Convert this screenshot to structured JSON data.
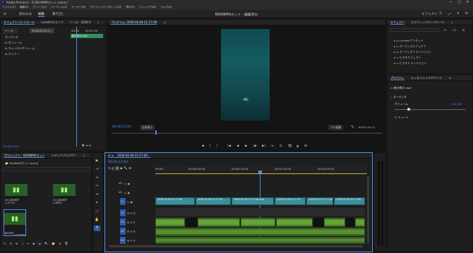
{
  "window": {
    "title": "Adobe Premiere - D:\\REANIMAカット.prproj *",
    "controls": [
      "—",
      "□",
      "✕"
    ]
  },
  "menu": [
    "ファイル(F)",
    "編集(E)",
    "クリップ(C)",
    "シーケンス(S)",
    "マーカー(M)",
    "グラフィックとタイトル(G)",
    "表示(V)",
    "ウィンドウ(W)",
    "ヘルプ(H)"
  ],
  "workspaces": {
    "home": "⌂",
    "items": [
      "読み込み",
      "編集",
      "書き出し"
    ],
    "active": "編集"
  },
  "doc_title": "REANIMAカット - 編集済み",
  "topright": {
    "label": "エフェクト",
    "icons": [
      "☰",
      "⤢",
      "⬆",
      "⚙"
    ]
  },
  "source_panel": {
    "tabs": [
      "エフェクトコントロール",
      "Lumetriスコープ",
      "ソース：2026-0",
      "»"
    ],
    "master": "ソース・",
    "seq": "2026-02-04 2...",
    "rows": [
      "オーディオ",
      "fx ボリューム",
      "fx チャンネルボリューム",
      "fx パンナー"
    ],
    "times": [
      "00:00",
      "00:01:00"
    ],
    "clip": "無の喝き.mp3",
    "timecode": "00:00:12:04"
  },
  "program": {
    "tab": "プログラム: 2026-02-04 21-17-00",
    "menu": "≡",
    "tc": "00:00:12:04",
    "fit": "全体表示",
    "quality": "フル画質",
    "wrench": "🔧",
    "duration": "00:01:15:11"
  },
  "transport": [
    "◆",
    "{",
    "}",
    "|◀",
    "◀|",
    "◀",
    "▶",
    "|▶",
    "▶|",
    "⇋",
    "⇆",
    "📷",
    "⧉",
    "⊞"
  ],
  "project": {
    "tabs": [
      "プロジェクト：REANIMAカット",
      "メディアブラウザー",
      "»"
    ],
    "path": "REANIMAカット.prproj",
    "items": [
      {
        "name": "003_無の喝き",
        "dur": "2:40:133"
      },
      {
        "name": "010_無の喝き",
        "dur": "2:48834"
      },
      {
        "name": "無の喝き",
        "dur": "1:00:38811"
      }
    ],
    "bottom_icons": [
      "✎",
      "☰",
      "⊞",
      "○",
      "═",
      "◆",
      "▤",
      "🔍",
      "📁",
      "⊕",
      "🗑"
    ]
  },
  "tools": [
    "▶",
    "⇥",
    "⇔",
    "✂",
    "↔",
    "✒",
    "▭",
    "✋",
    "T"
  ],
  "timeline": {
    "tab": "2026-02-04 21-17-00",
    "tc": "00:00:12:04",
    "ruler_labels": [
      "00:00",
      "00:00:05:00",
      "00:00:10:00",
      "00:00:15:00",
      "00:00:20:00"
    ],
    "tracks": [
      {
        "id": "V3",
        "type": "video"
      },
      {
        "id": "V2",
        "type": "video"
      },
      {
        "id": "V1",
        "type": "video"
      },
      {
        "id": "A1",
        "type": "audio"
      },
      {
        "id": "A2",
        "type": "audio"
      },
      {
        "id": "A3",
        "type": "audio"
      },
      {
        "id": "A4",
        "type": "audio"
      }
    ],
    "v1_clips": [
      "2026-02-04 21-17-00",
      "2026-02-04 21-17-00",
      "2026-02-04 21-17-00.mp4",
      "2026-02-04 21-17-0",
      "2026-02-04 21-17-00",
      "2026-02-04 21-17-00"
    ]
  },
  "effects_panel": {
    "tabs": [
      "エフェクト",
      "グラフィックテンプレート",
      "»"
    ],
    "tags": [
      "≡",
      "CC",
      "⊟"
    ],
    "items": [
      "Lumetriプリセット",
      "オーディオエフェクト",
      "オーディオトランジション",
      "ビデオエフェクト",
      "ビデオトランジション"
    ]
  },
  "properties": {
    "tabs": [
      "プロパティ",
      "エッセンシャルサウンド",
      "≡"
    ],
    "clip": "無の喝き.mp3",
    "section": "オーディオ",
    "volume_label": "ボリューム",
    "volume_value": "16.0 dB",
    "mute_label": "ミュート"
  }
}
